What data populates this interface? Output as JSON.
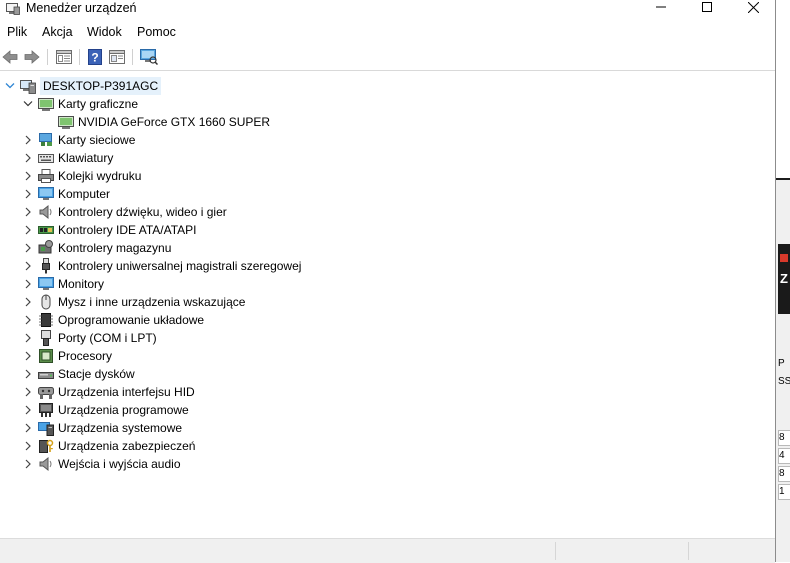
{
  "window": {
    "title": "Menedżer urządzeń"
  },
  "menu": [
    "Plik",
    "Akcja",
    "Widok",
    "Pomoc"
  ],
  "toolbar": {
    "buttons": [
      "back-arrow-icon",
      "forward-arrow-icon",
      "properties-icon",
      "help-icon",
      "view-icon",
      "scan-hardware-icon"
    ]
  },
  "tree": {
    "root": "DESKTOP-P391AGC",
    "expanded_category": "Karty graficzne",
    "expanded_child": "NVIDIA GeForce GTX 1660 SUPER",
    "categories": [
      "Karty sieciowe",
      "Klawiatury",
      "Kolejki wydruku",
      "Komputer",
      "Kontrolery dźwięku, wideo i gier",
      "Kontrolery IDE ATA/ATAPI",
      "Kontrolery magazynu",
      "Kontrolery uniwersalnej magistrali szeregowej",
      "Monitory",
      "Mysz i inne urządzenia wskazujące",
      "Oprogramowanie układowe",
      "Porty (COM i LPT)",
      "Procesory",
      "Stacje dysków",
      "Urządzenia interfejsu HID",
      "Urządzenia programowe",
      "Urządzenia systemowe",
      "Urządzenia zabezpieczeń",
      "Wejścia i wyjścia audio"
    ]
  },
  "background_window": {
    "logo_letter": "Z",
    "labels": [
      "P",
      "SSE"
    ],
    "cells": [
      "8",
      "4",
      "8",
      "1"
    ]
  }
}
